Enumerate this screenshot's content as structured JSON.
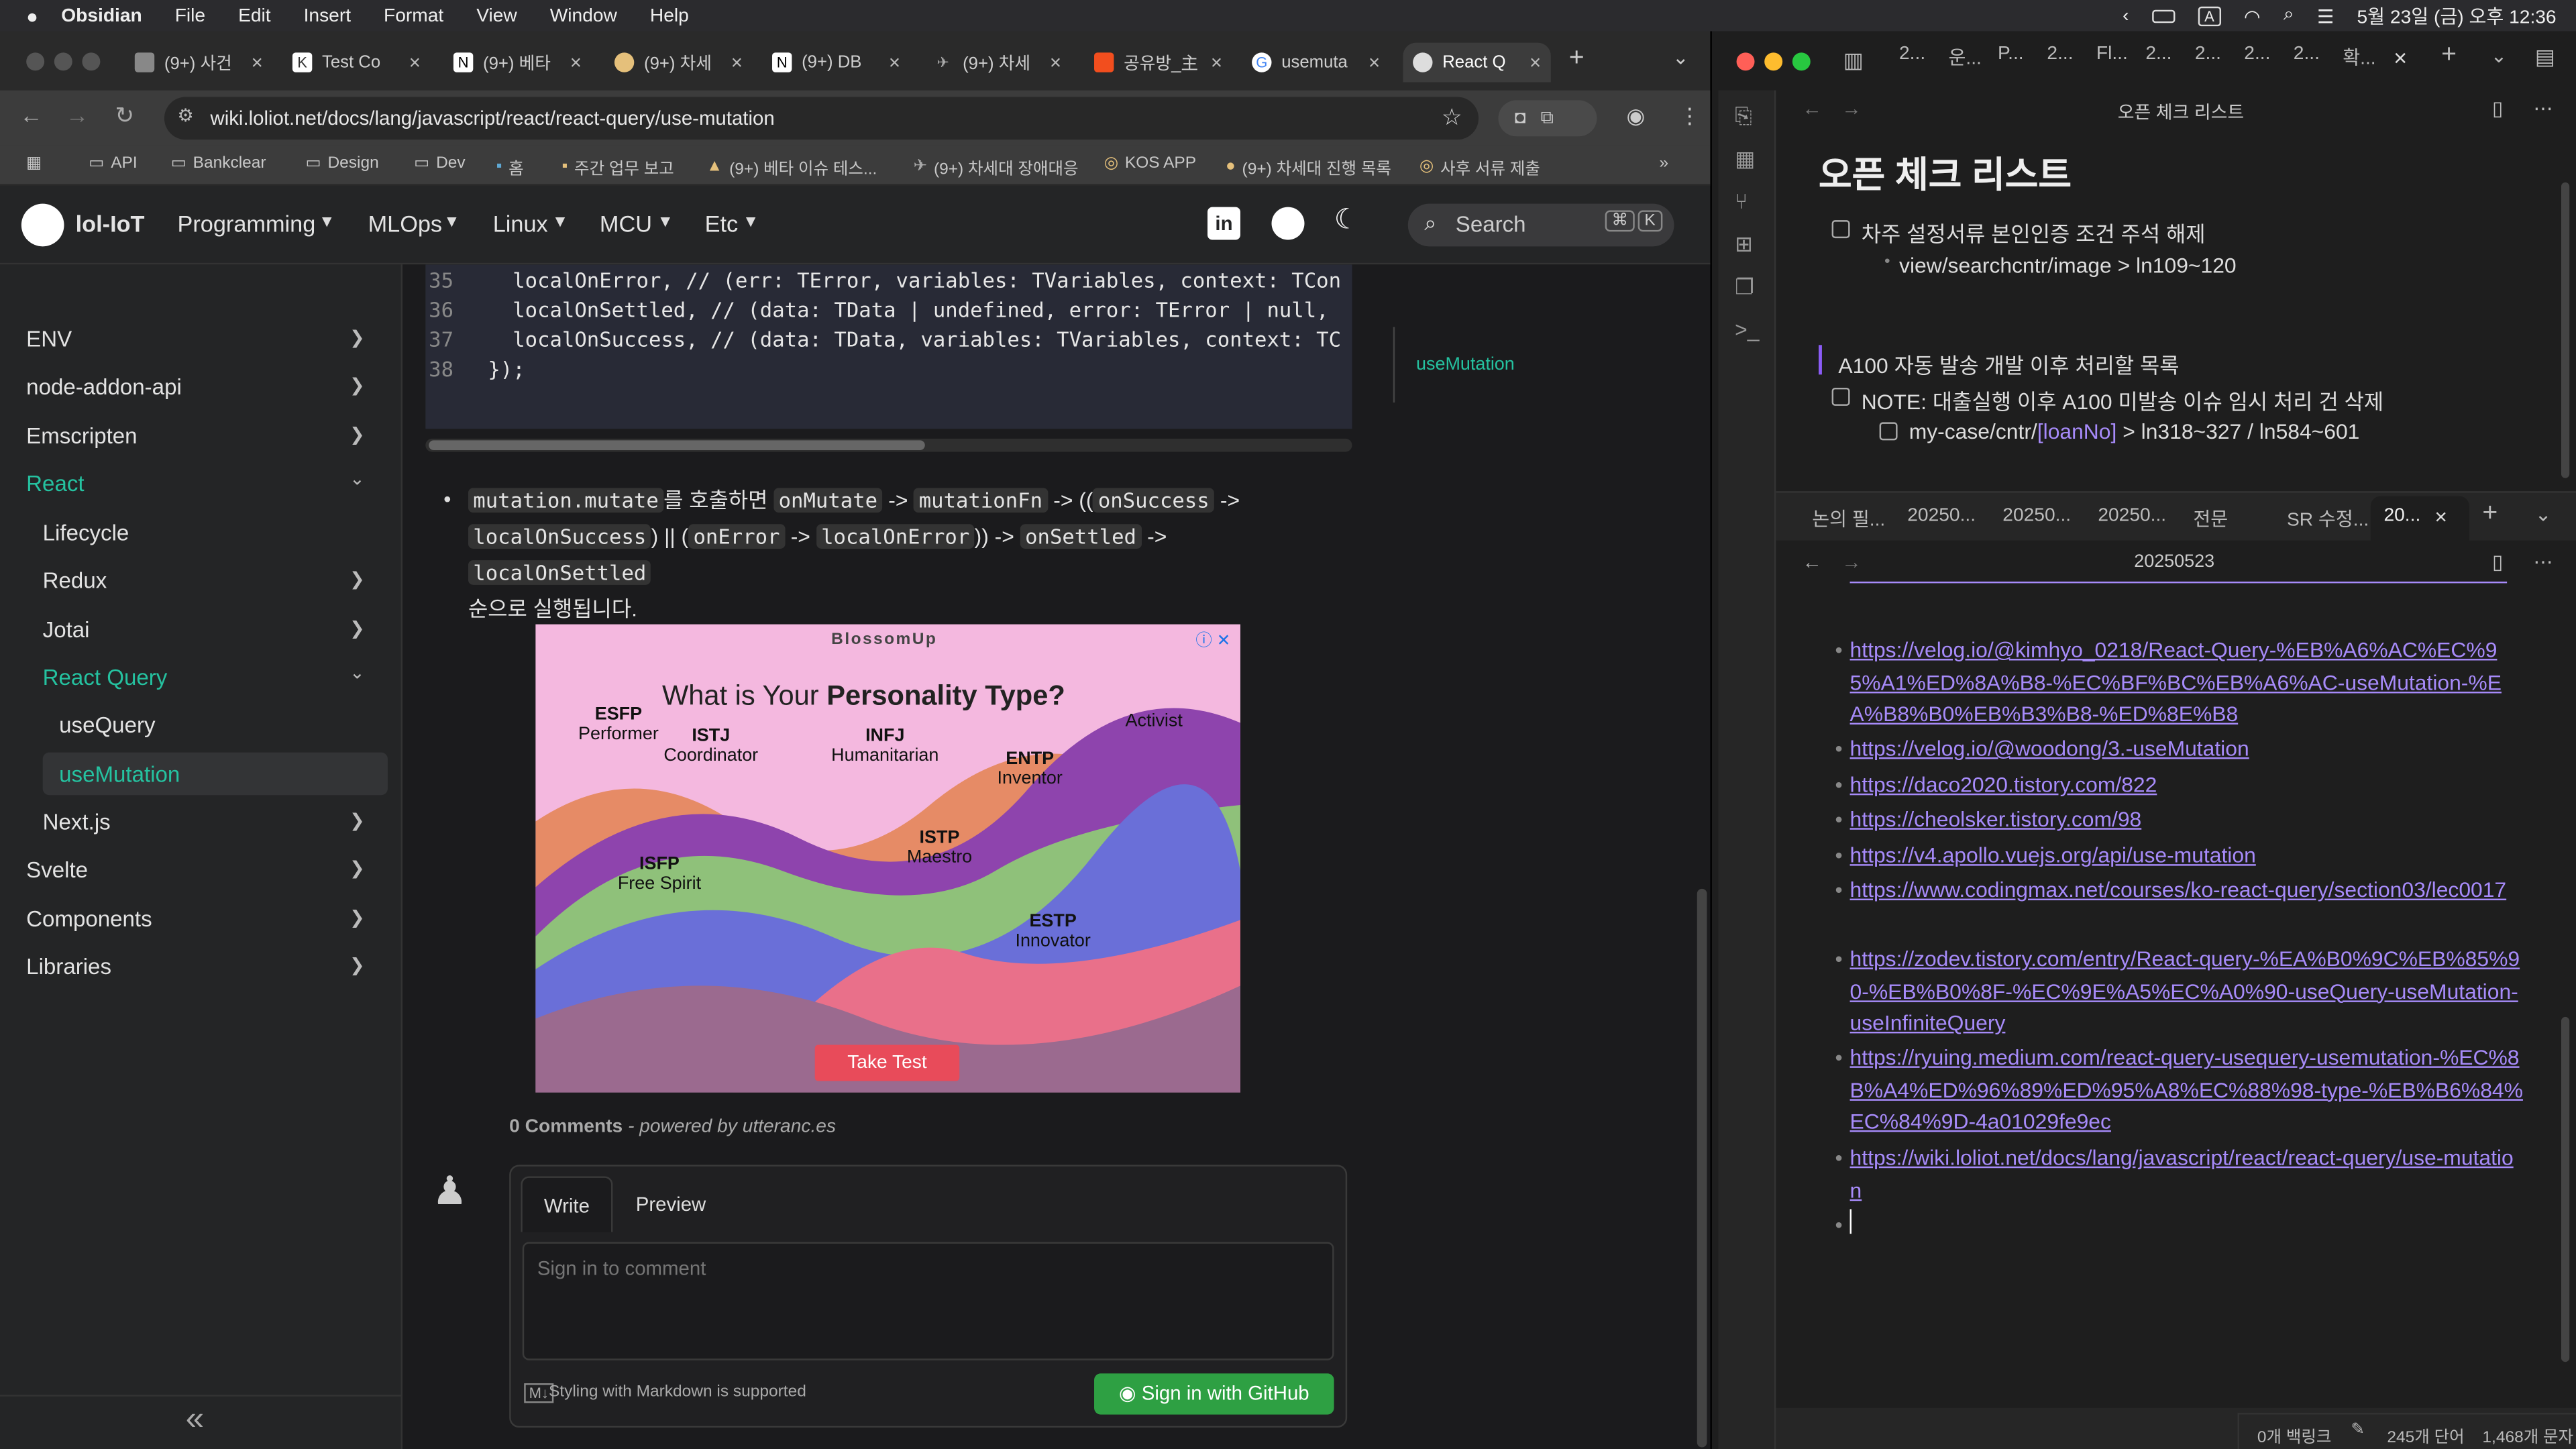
{
  "menubar": {
    "app": "Obsidian",
    "items": [
      "File",
      "Edit",
      "Insert",
      "Format",
      "View",
      "Window",
      "Help"
    ],
    "clock": "5월 23일 (금) 오후 12:36",
    "input_indicator": "A"
  },
  "browser": {
    "tabs": [
      "(9+) 사건",
      "Test Co",
      "(9+) 베타",
      "(9+) 차세",
      "(9+) DB",
      "(9+) 차세",
      "공유방_主",
      "usemuta",
      "React Q"
    ],
    "url": "wiki.loliot.net/docs/lang/javascript/react/react-query/use-mutation",
    "bookmarks": [
      "API",
      "Bankclear",
      "Design",
      "Dev",
      "홈",
      "주간 업무 보고",
      "(9+) 베타 이슈 테스...",
      "(9+) 차세대 장애대응",
      "KOS APP",
      "(9+) 차세대 진행 목록",
      "사후 서류 제출"
    ]
  },
  "site": {
    "brand": "lol-IoT",
    "nav": [
      "Programming",
      "MLOps",
      "Linux",
      "MCU",
      "Etc"
    ],
    "search_placeholder": "Search",
    "kbd1": "⌘",
    "kbd2": "K",
    "sidebar": [
      {
        "label": "ENV",
        "chev": "›"
      },
      {
        "label": "node-addon-api",
        "chev": "›"
      },
      {
        "label": "Emscripten",
        "chev": "›"
      },
      {
        "label": "React",
        "chev": "⌄"
      },
      {
        "label": "Lifecycle",
        "chev": ""
      },
      {
        "label": "Redux",
        "chev": "›"
      },
      {
        "label": "Jotai",
        "chev": "›"
      },
      {
        "label": "React Query",
        "chev": "⌄"
      },
      {
        "label": "useQuery",
        "chev": ""
      },
      {
        "label": "useMutation",
        "chev": ""
      },
      {
        "label": "Next.js",
        "chev": "›"
      },
      {
        "label": "Svelte",
        "chev": "›"
      },
      {
        "label": "Components",
        "chev": "›"
      },
      {
        "label": "Libraries",
        "chev": "›"
      }
    ],
    "code_lines": [
      {
        "n": "35",
        "t": "  localOnError, // (err: TError, variables: TVariables, context: TCon"
      },
      {
        "n": "36",
        "t": "  localOnSettled, // (data: TData | undefined, error: TError | null,"
      },
      {
        "n": "37",
        "t": "  localOnSuccess, // (data: TData, variables: TVariables, context: TC"
      },
      {
        "n": "38",
        "t": "});"
      }
    ],
    "toc": "useMutation",
    "para": {
      "c1": "mutation.mutate",
      "t1": "를 호출하면 ",
      "c2": "onMutate",
      "t2": " -> ",
      "c3": "mutationFn",
      "t3": " -> ((",
      "c4": "onSuccess",
      "t4": " ->",
      "c5": "localOnSuccess",
      "t5": ") || (",
      "c6": "onError",
      "t6": " -> ",
      "c7": "localOnError",
      "t7": ")) -> ",
      "c8": "onSettled",
      "t8": " -> ",
      "c9": "localOnSettled",
      "t9": "순으로 실행됩니다."
    },
    "ad": {
      "brand": "BlossomUp",
      "headline": "What is Your ",
      "headline_bold": "Personality Type?",
      "types": [
        {
          "code": "ESFP",
          "name": "Performer"
        },
        {
          "code": "ISTJ",
          "name": "Coordinator"
        },
        {
          "code": "INFJ",
          "name": "Humanitarian"
        },
        {
          "code": "ENTP",
          "name": "Inventor"
        },
        {
          "code": "",
          "name": "Activist"
        },
        {
          "code": "ISFP",
          "name": "Free Spirit"
        },
        {
          "code": "ISTP",
          "name": "Maestro"
        },
        {
          "code": "ESTP",
          "name": "Innovator"
        }
      ],
      "cta": "Take Test"
    },
    "comments": {
      "count": "0 Comments",
      "powered": " - powered by utteranc.es",
      "write": "Write",
      "preview": "Preview",
      "placeholder": "Sign in to comment",
      "markdown": "Styling with Markdown is supported",
      "signin": "Sign in with GitHub"
    }
  },
  "obsidian": {
    "tabs_top": [
      "2...",
      "운...",
      "P...",
      "2...",
      "Fl...",
      "2...",
      "2...",
      "2...",
      "2...",
      "확..."
    ],
    "pane1_title": "오픈 체크 리스트",
    "pane1_heading": "오픈 체크 리스트",
    "pane1_items": {
      "task1": "차주 설정서류 본인인증 조건 주석 해제",
      "sub1": "view/searchcntr/image > ln109~120",
      "quote": "A100 자동 발송 개발 이후 처리할 목록",
      "task2": "NOTE: 대출실행 이후 A100 미발송 이슈 임시 처리 건 삭제",
      "sub2a": "my-case/cntr/",
      "sub2b": "[loanNo]",
      "sub2c": " > ln318~327 / ln584~601"
    },
    "tabs_mid": [
      "논의 필...",
      "20250...",
      "20250...",
      "20250...",
      "전문",
      "SR 수정...",
      "20..."
    ],
    "pane2_title": "20250523",
    "links": [
      "https://velog.io/@kimhyo_0218/React-Query-%EB%A6%AC%EC%95%A1%ED%8A%B8-%EC%BF%BC%EB%A6%AC-useMutation-%EA%B8%B0%EB%B3%B8-%ED%8E%B8",
      "https://velog.io/@woodong/3.-useMutation",
      "https://daco2020.tistory.com/822",
      "https://cheolsker.tistory.com/98",
      "https://v4.apollo.vuejs.org/api/use-mutation",
      "https://www.codingmax.net/courses/ko-react-query/section03/lec0017",
      "https://zodev.tistory.com/entry/React-query-%EA%B0%9C%EB%85%90-%EB%B0%8F-%EC%9E%A5%EC%A0%90-useQuery-useMutation-useInfiniteQuery",
      "https://ryuing.medium.com/react-query-usequery-usemutation-%EC%8B%A4%ED%96%89%ED%95%A8%EC%88%98-type-%EB%B6%84%EC%84%9D-4a01029fe9ec",
      "https://wiki.loliot.net/docs/lang/javascript/react/react-query/use-mutation"
    ],
    "status": {
      "backlinks": "0개 백링크",
      "words": "245개 단어",
      "chars": "1,468개 문자"
    }
  },
  "colors": {
    "accent_green": "#25c2a0",
    "link_purple": "#a78bfa",
    "github_green": "#2ea043"
  }
}
